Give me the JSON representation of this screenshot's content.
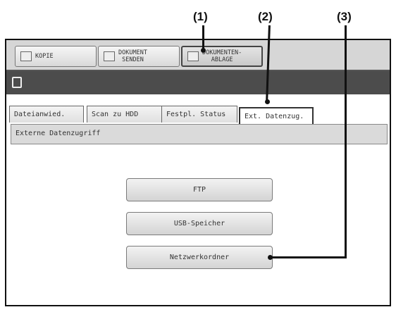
{
  "callouts": [
    "(1)",
    "(2)",
    "(3)"
  ],
  "mode_buttons": [
    {
      "label": "KOPIE",
      "icon": "copy-icon"
    },
    {
      "label": "DOKUMENT\nSENDEN",
      "icon": "send-icon"
    },
    {
      "label": "DOKUMENTEN-\nABLAGE",
      "icon": "filing-icon"
    }
  ],
  "tabs": [
    {
      "label": "Dateianwied."
    },
    {
      "label": "Scan zu HDD"
    },
    {
      "label": "Festpl. Status"
    },
    {
      "label": "Ext. Datenzug."
    }
  ],
  "section_title": "Externe Datenzugriff",
  "buttons": [
    {
      "label": "FTP"
    },
    {
      "label": "USB-Speicher"
    },
    {
      "label": "Netzwerkordner"
    }
  ]
}
